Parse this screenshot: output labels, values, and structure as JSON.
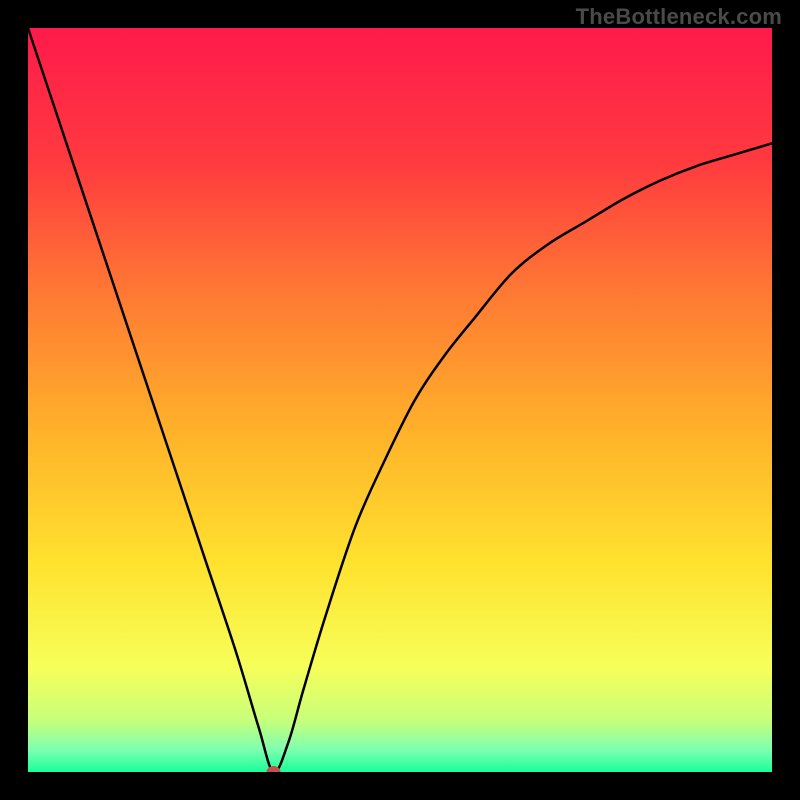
{
  "watermark": "TheBottleneck.com",
  "chart_data": {
    "type": "line",
    "title": "",
    "xlabel": "",
    "ylabel": "",
    "xlim": [
      0,
      100
    ],
    "ylim": [
      0,
      100
    ],
    "x_at_min": 33,
    "background_gradient_stops": [
      {
        "offset": 0.0,
        "color": "#ff1a4b"
      },
      {
        "offset": 0.18,
        "color": "#ff3a3f"
      },
      {
        "offset": 0.36,
        "color": "#ff7a33"
      },
      {
        "offset": 0.55,
        "color": "#ffb42a"
      },
      {
        "offset": 0.72,
        "color": "#ffe22e"
      },
      {
        "offset": 0.86,
        "color": "#f6ff5a"
      },
      {
        "offset": 0.93,
        "color": "#c8ff7a"
      },
      {
        "offset": 0.97,
        "color": "#7dffb0"
      },
      {
        "offset": 1.0,
        "color": "#19ff9a"
      }
    ],
    "marker": {
      "x": 33,
      "y": 0,
      "color": "#c1524c",
      "rx": 7,
      "ry": 6
    },
    "series": [
      {
        "name": "bottleneck-curve",
        "color": "#000000",
        "x": [
          0,
          4,
          8,
          12,
          16,
          20,
          24,
          28,
          31,
          33,
          35,
          37,
          40,
          44,
          48,
          52,
          56,
          60,
          65,
          70,
          75,
          80,
          85,
          90,
          95,
          100
        ],
        "y": [
          100,
          88,
          76,
          64,
          52,
          40,
          28,
          16,
          6,
          0,
          4,
          11,
          21,
          33,
          42,
          50,
          56,
          61,
          67,
          71,
          74,
          77,
          79.5,
          81.5,
          83,
          84.5
        ]
      }
    ]
  }
}
